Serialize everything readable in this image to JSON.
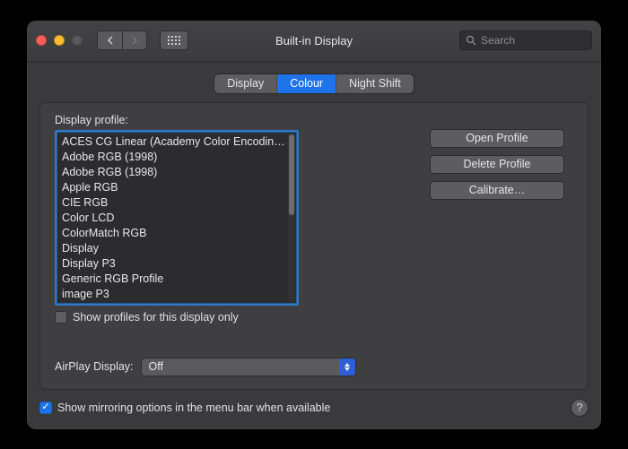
{
  "window": {
    "title": "Built-in Display",
    "search_placeholder": "Search"
  },
  "tabs": {
    "display": "Display",
    "colour": "Colour",
    "night_shift": "Night Shift",
    "active": "colour"
  },
  "profile_section": {
    "label": "Display profile:",
    "profiles": [
      "ACES CG Linear (Academy Color Encoding…",
      "Adobe RGB (1998)",
      "Adobe RGB (1998)",
      "Apple RGB",
      "CIE RGB",
      "Color LCD",
      "ColorMatch RGB",
      "Display",
      "Display P3",
      "Generic RGB Profile",
      "image P3"
    ],
    "show_only_label": "Show profiles for this display only",
    "show_only_checked": false
  },
  "buttons": {
    "open_profile": "Open Profile",
    "delete_profile": "Delete Profile",
    "calibrate": "Calibrate…"
  },
  "airplay": {
    "label": "AirPlay Display:",
    "value": "Off"
  },
  "footer": {
    "mirror_label": "Show mirroring options in the menu bar when available",
    "mirror_checked": true,
    "help": "?"
  }
}
